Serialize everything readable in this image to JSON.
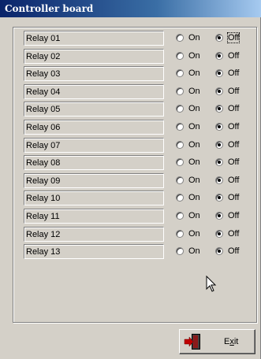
{
  "window": {
    "title": "Controller board"
  },
  "relays": [
    {
      "label": "Relay 01",
      "on_label": "On",
      "off_label": "Off",
      "state": "Off"
    },
    {
      "label": "Relay 02",
      "on_label": "On",
      "off_label": "Off",
      "state": "Off"
    },
    {
      "label": "Relay 03",
      "on_label": "On",
      "off_label": "Off",
      "state": "Off"
    },
    {
      "label": "Relay 04",
      "on_label": "On",
      "off_label": "Off",
      "state": "Off"
    },
    {
      "label": "Relay 05",
      "on_label": "On",
      "off_label": "Off",
      "state": "Off"
    },
    {
      "label": "Relay 06",
      "on_label": "On",
      "off_label": "Off",
      "state": "Off"
    },
    {
      "label": "Relay 07",
      "on_label": "On",
      "off_label": "Off",
      "state": "Off"
    },
    {
      "label": "Relay 08",
      "on_label": "On",
      "off_label": "Off",
      "state": "Off"
    },
    {
      "label": "Relay 09",
      "on_label": "On",
      "off_label": "Off",
      "state": "Off"
    },
    {
      "label": "Relay 10",
      "on_label": "On",
      "off_label": "Off",
      "state": "Off"
    },
    {
      "label": "Relay 11",
      "on_label": "On",
      "off_label": "Off",
      "state": "Off"
    },
    {
      "label": "Relay 12",
      "on_label": "On",
      "off_label": "Off",
      "state": "Off"
    },
    {
      "label": "Relay 13",
      "on_label": "On",
      "off_label": "Off",
      "state": "Off"
    }
  ],
  "exit_button": {
    "label_first": "E",
    "label_underlined": "x",
    "label_rest": "it",
    "icon": "exit-door-icon"
  },
  "colors": {
    "titlebar_start": "#0a246a",
    "titlebar_end": "#a6caf0",
    "face": "#d4d0c8"
  }
}
